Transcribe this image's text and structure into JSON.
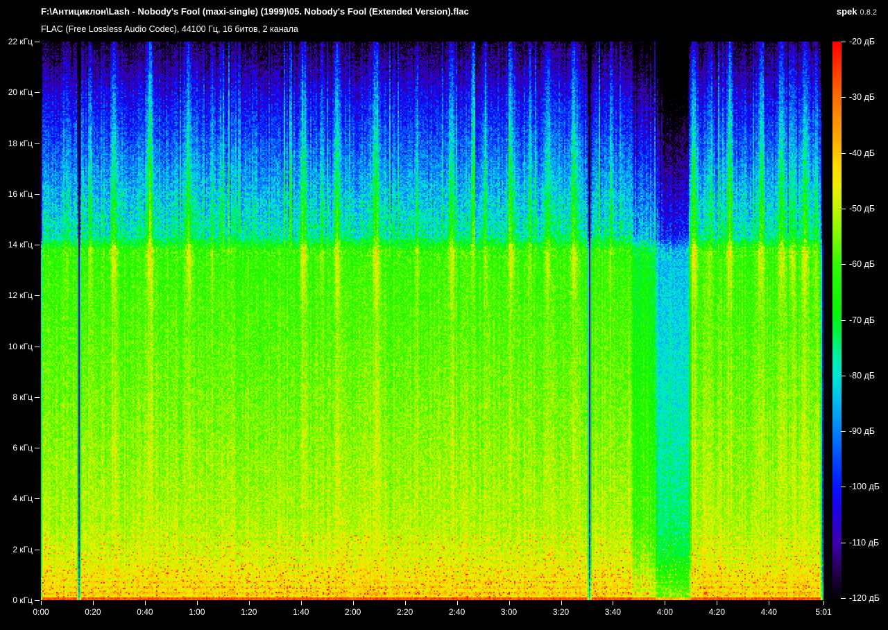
{
  "app": {
    "name": "spek",
    "version": "0.8.2"
  },
  "header": {
    "file_path": "F:\\Антициклон\\Lash - Nobody's Fool (maxi-single) (1999)\\05. Nobody's Fool (Extended Version).flac",
    "format_info": "FLAC (Free Lossless Audio Codec), 44100 Гц, 16 битов, 2 канала"
  },
  "axes": {
    "freq": {
      "unit": "кГц",
      "min_khz": 0,
      "max_khz": 22,
      "ticks": [
        {
          "value": 22,
          "label": "22 кГц"
        },
        {
          "value": 20,
          "label": "20 кГц"
        },
        {
          "value": 18,
          "label": "18 кГц"
        },
        {
          "value": 16,
          "label": "16 кГц"
        },
        {
          "value": 14,
          "label": "14 кГц"
        },
        {
          "value": 12,
          "label": "12 кГц"
        },
        {
          "value": 10,
          "label": "10 кГц"
        },
        {
          "value": 8,
          "label": "8 кГц"
        },
        {
          "value": 6,
          "label": "6 кГц"
        },
        {
          "value": 4,
          "label": "4 кГц"
        },
        {
          "value": 2,
          "label": "2 кГц"
        },
        {
          "value": 0,
          "label": "0 кГц"
        }
      ]
    },
    "time": {
      "duration_sec": 301,
      "ticks": [
        {
          "sec": 0,
          "label": "0:00"
        },
        {
          "sec": 20,
          "label": "0:20"
        },
        {
          "sec": 40,
          "label": "0:40"
        },
        {
          "sec": 60,
          "label": "1:00"
        },
        {
          "sec": 80,
          "label": "1:20"
        },
        {
          "sec": 100,
          "label": "1:40"
        },
        {
          "sec": 120,
          "label": "2:00"
        },
        {
          "sec": 140,
          "label": "2:20"
        },
        {
          "sec": 160,
          "label": "2:40"
        },
        {
          "sec": 180,
          "label": "3:00"
        },
        {
          "sec": 200,
          "label": "3:20"
        },
        {
          "sec": 220,
          "label": "3:40"
        },
        {
          "sec": 240,
          "label": "4:00"
        },
        {
          "sec": 260,
          "label": "4:20"
        },
        {
          "sec": 280,
          "label": "4:40"
        },
        {
          "sec": 301,
          "label": "5:01"
        }
      ]
    },
    "level": {
      "unit": "дБ",
      "max_db": -20,
      "min_db": -120,
      "ticks": [
        {
          "db": -20,
          "label": "-20 дБ"
        },
        {
          "db": -30,
          "label": "-30 дБ"
        },
        {
          "db": -40,
          "label": "-40 дБ"
        },
        {
          "db": -50,
          "label": "-50 дБ"
        },
        {
          "db": -60,
          "label": "-60 дБ"
        },
        {
          "db": -70,
          "label": "-70 дБ"
        },
        {
          "db": -80,
          "label": "-80 дБ"
        },
        {
          "db": -90,
          "label": "-90 дБ"
        },
        {
          "db": -100,
          "label": "-100 дБ"
        },
        {
          "db": -110,
          "label": "-110 дБ"
        },
        {
          "db": -120,
          "label": "-120 дБ"
        }
      ]
    }
  },
  "palette": [
    [
      -120,
      "#000000"
    ],
    [
      -116,
      "#1c0038"
    ],
    [
      -110,
      "#3c00aa"
    ],
    [
      -104,
      "#2000e0"
    ],
    [
      -100,
      "#0810ff"
    ],
    [
      -95,
      "#0048ff"
    ],
    [
      -90,
      "#0080ff"
    ],
    [
      -85,
      "#00b4f0"
    ],
    [
      -80,
      "#00e4d8"
    ],
    [
      -76,
      "#00f0a0"
    ],
    [
      -72,
      "#00f23c"
    ],
    [
      -68,
      "#0cf408"
    ],
    [
      -60,
      "#30fa00"
    ],
    [
      -55,
      "#7cf800"
    ],
    [
      -50,
      "#c0f400"
    ],
    [
      -46,
      "#ecf000"
    ],
    [
      -42,
      "#ffd800"
    ],
    [
      -38,
      "#ffb000"
    ],
    [
      -30,
      "#ff6e00"
    ],
    [
      -25,
      "#ff3800"
    ],
    [
      -20,
      "#ff0000"
    ]
  ],
  "spectrogram": {
    "seed": 1337,
    "duration_sec": 301,
    "max_freq_khz": 22,
    "base_curve_khz_db": [
      [
        0.0,
        -29
      ],
      [
        0.09,
        -31
      ],
      [
        0.14,
        -42
      ],
      [
        0.9,
        -44
      ],
      [
        1.5,
        -47
      ],
      [
        3.0,
        -51
      ],
      [
        6.0,
        -54
      ],
      [
        10.0,
        -57.5
      ],
      [
        13.75,
        -61
      ],
      [
        14.35,
        -77
      ],
      [
        16.0,
        -84
      ],
      [
        18.0,
        -94
      ],
      [
        20.0,
        -104
      ],
      [
        21.0,
        -111
      ],
      [
        21.6,
        -115
      ],
      [
        22.0,
        -119
      ]
    ],
    "bright_columns": [
      {
        "t": 10,
        "w": 1.5,
        "boost": 10
      },
      {
        "t": 19,
        "w": 1.5,
        "boost": 12
      },
      {
        "t": 28,
        "w": 2.0,
        "boost": 16
      },
      {
        "t": 42,
        "w": 2.5,
        "boost": 16
      },
      {
        "t": 57,
        "w": 2.5,
        "boost": 17
      },
      {
        "t": 66,
        "w": 1.5,
        "boost": 10
      },
      {
        "t": 101,
        "w": 2.5,
        "boost": 16
      },
      {
        "t": 108,
        "w": 1.5,
        "boost": 10
      },
      {
        "t": 114,
        "w": 2.0,
        "boost": 15
      },
      {
        "t": 129,
        "w": 2.5,
        "boost": 16
      },
      {
        "t": 145,
        "w": 1.5,
        "boost": 9
      },
      {
        "t": 158,
        "w": 2.5,
        "boost": 15
      },
      {
        "t": 166,
        "w": 1.5,
        "boost": 10
      },
      {
        "t": 171,
        "w": 1.5,
        "boost": 11
      },
      {
        "t": 181,
        "w": 2.5,
        "boost": 16
      },
      {
        "t": 188,
        "w": 1.5,
        "boost": 9
      },
      {
        "t": 195,
        "w": 2.0,
        "boost": 14
      },
      {
        "t": 205,
        "w": 2.5,
        "boost": 16
      },
      {
        "t": 219,
        "w": 1.5,
        "boost": 9
      },
      {
        "t": 251,
        "w": 3.0,
        "boost": 18
      },
      {
        "t": 257,
        "w": 1.5,
        "boost": 10
      },
      {
        "t": 265,
        "w": 2.5,
        "boost": 15
      },
      {
        "t": 277,
        "w": 2.5,
        "boost": 15
      },
      {
        "t": 285,
        "w": 2.5,
        "boost": 14
      },
      {
        "t": 289,
        "w": 2.0,
        "boost": 13
      },
      {
        "t": 294,
        "w": 2.5,
        "boost": 15
      },
      {
        "t": 298,
        "w": 1.5,
        "boost": 10
      }
    ],
    "silence_lines": [
      {
        "t": 14.7,
        "w": 0.9,
        "drop": -48
      },
      {
        "t": 211,
        "w": 0.9,
        "drop": -48
      }
    ],
    "quiet_sections": [
      {
        "start": 228,
        "end": 237,
        "drop": -8
      },
      {
        "start": 237,
        "end": 249,
        "drop": -22
      }
    ],
    "intro_fade_sec": 0.6,
    "outro_fade_sec": 1.2
  },
  "layout_note": "spectrogram plot area maps 0:00-5:01 horizontally and 0-22 кГц vertically; legend maps -20 дБ (red) to -120 дБ (black)"
}
